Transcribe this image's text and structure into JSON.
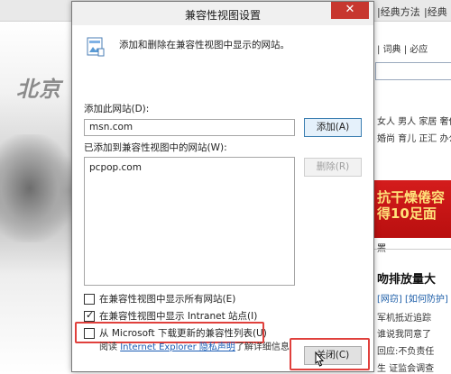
{
  "background_page": {
    "topbar_items": [
      "|经典方法",
      "|经典"
    ],
    "city_text": "北京",
    "right_lines": [
      {
        "text": "|  词典  |  必应",
        "cls": ""
      },
      {
        "text": "女人  男人  家居  奢侈",
        "cls": ""
      },
      {
        "text": "婚尚  育儿  正汇  办公",
        "cls": ""
      },
      {
        "text": "罴",
        "cls": ""
      },
      {
        "text": "[网窃] [如何防护]",
        "cls": "blue"
      },
      {
        "text": "军机抵近追踪",
        "cls": ""
      },
      {
        "text": "谁说我同意了",
        "cls": ""
      },
      {
        "text": "回应:不负责任",
        "cls": ""
      },
      {
        "text": "生 证监会调查",
        "cls": ""
      }
    ],
    "ad_lines": [
      "抗干燥倦容",
      "得10足面"
    ],
    "headline": "吻排放量大"
  },
  "dialog": {
    "title": "兼容性视图设置",
    "close_glyph": "✕",
    "header_text": "添加和删除在兼容性视图中显示的网站。",
    "add_site_label": "添加此网站(D):",
    "add_site_value": "msn.com",
    "add_button": "添加(A)",
    "sites_label": "已添加到兼容性视图中的网站(W):",
    "sites": [
      "pcpop.com"
    ],
    "remove_button": "删除(R)",
    "checkboxes": [
      {
        "label": "在兼容性视图中显示所有网站(E)",
        "checked": false
      },
      {
        "label": "在兼容性视图中显示 Intranet 站点(I)",
        "checked": true
      },
      {
        "label": "从 Microsoft 下载更新的兼容性列表(U)",
        "checked": false
      }
    ],
    "info_prefix": "阅读 ",
    "info_link": "Internet Explorer 隐私声明",
    "info_suffix": "了解详细信息",
    "close_button": "关闭(C)",
    "highlight_color": "#e0403c"
  }
}
